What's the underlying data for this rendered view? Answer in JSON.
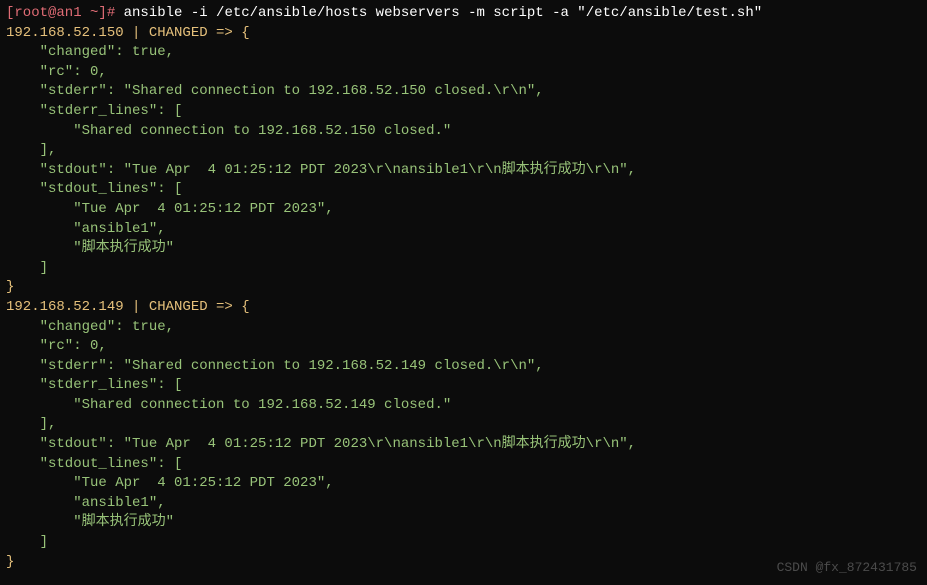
{
  "prompt": {
    "user_host": "[root@an1 ~]# ",
    "command": "ansible -i /etc/ansible/hosts webservers -m script -a \"/etc/ansible/test.sh\""
  },
  "hosts": [
    {
      "header": "192.168.52.150 | CHANGED => {",
      "changed_line": "    \"changed\": true,",
      "rc_line": "    \"rc\": 0,",
      "stderr_line": "    \"stderr\": \"Shared connection to 192.168.52.150 closed.\\r\\n\",",
      "stderr_lines_open": "    \"stderr_lines\": [",
      "stderr_lines_item": "        \"Shared connection to 192.168.52.150 closed.\"",
      "stderr_lines_close": "    ],",
      "stdout_line": "    \"stdout\": \"Tue Apr  4 01:25:12 PDT 2023\\r\\nansible1\\r\\n脚本执行成功\\r\\n\",",
      "stdout_lines_open": "    \"stdout_lines\": [",
      "stdout_lines_item1": "        \"Tue Apr  4 01:25:12 PDT 2023\",",
      "stdout_lines_item2": "        \"ansible1\",",
      "stdout_lines_item3": "        \"脚本执行成功\"",
      "stdout_lines_close": "    ]",
      "close": "}"
    },
    {
      "header": "192.168.52.149 | CHANGED => {",
      "changed_line": "    \"changed\": true,",
      "rc_line": "    \"rc\": 0,",
      "stderr_line": "    \"stderr\": \"Shared connection to 192.168.52.149 closed.\\r\\n\",",
      "stderr_lines_open": "    \"stderr_lines\": [",
      "stderr_lines_item": "        \"Shared connection to 192.168.52.149 closed.\"",
      "stderr_lines_close": "    ],",
      "stdout_line": "    \"stdout\": \"Tue Apr  4 01:25:12 PDT 2023\\r\\nansible1\\r\\n脚本执行成功\\r\\n\",",
      "stdout_lines_open": "    \"stdout_lines\": [",
      "stdout_lines_item1": "        \"Tue Apr  4 01:25:12 PDT 2023\",",
      "stdout_lines_item2": "        \"ansible1\",",
      "stdout_lines_item3": "        \"脚本执行成功\"",
      "stdout_lines_close": "    ]",
      "close": "}"
    }
  ],
  "watermark": "CSDN @fx_872431785"
}
